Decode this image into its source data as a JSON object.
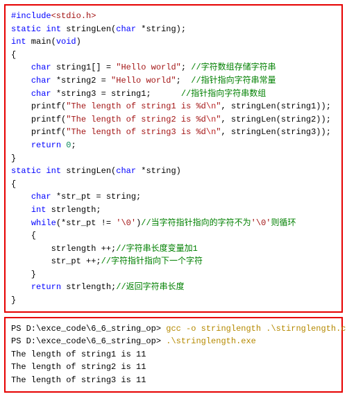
{
  "code": {
    "l1_pre": "#include",
    "l1_inc": "<stdio.h>",
    "l2_kw1": "static",
    "l2_kw2": "int",
    "l2_fn": " stringLen(",
    "l2_kw3": "char",
    "l2_rest": " *string);",
    "l3_kw1": "int",
    "l3_fn": " main(",
    "l3_kw2": "void",
    "l3_rest": ")",
    "l4": "{",
    "l5_ind": "    ",
    "l5_kw": "char",
    "l5_mid": " string1[] = ",
    "l5_str": "\"Hello world\"",
    "l5_semi": "; ",
    "l5_cmt": "//字符数组存储字符串",
    "l6_ind": "    ",
    "l6_kw": "char",
    "l6_mid": " *string2 = ",
    "l6_str": "\"Hello world\"",
    "l6_semi": ";  ",
    "l6_cmt": "//指针指向字符串常量",
    "l7_ind": "    ",
    "l7_kw": "char",
    "l7_mid": " *string3 = string1;      ",
    "l7_cmt": "//指针指向字符串数组",
    "l8_ind": "    ",
    "l8_fn": "printf(",
    "l8_str_a": "\"The length of string1 is ",
    "l8_fmt": "%d",
    "l8_nl": "\\n",
    "l8_str_b": "\"",
    "l8_rest": ", stringLen(string1));",
    "l9_ind": "    ",
    "l9_fn": "printf(",
    "l9_str_a": "\"The length of string2 is ",
    "l9_fmt": "%d",
    "l9_nl": "\\n",
    "l9_str_b": "\"",
    "l9_rest": ", stringLen(string2));",
    "l10_ind": "    ",
    "l10_fn": "printf(",
    "l10_str_a": "\"The length of string3 is ",
    "l10_fmt": "%d",
    "l10_nl": "\\n",
    "l10_str_b": "\"",
    "l10_rest": ", stringLen(string3));",
    "l11_ind": "    ",
    "l11_kw": "return",
    "l11_sp": " ",
    "l11_num": "0",
    "l11_semi": ";",
    "l12": "}",
    "l13_kw1": "static",
    "l13_kw2": "int",
    "l13_fn": " stringLen(",
    "l13_kw3": "char",
    "l13_rest": " *string)",
    "l14": "{",
    "l15_ind": "    ",
    "l15_kw": "char",
    "l15_rest": " *str_pt = string;",
    "l16_ind": "    ",
    "l16_kw": "int",
    "l16_rest": " strlength;",
    "l17_ind": "    ",
    "l17_kw": "while",
    "l17_mid": "(*str_pt != ",
    "l17_chr": "'\\0'",
    "l17_close": ")",
    "l17_cmt_a": "//当字符指针指向的字符不为",
    "l17_chr2": "'\\0'",
    "l17_cmt_b": "则循环",
    "l18": "    {",
    "l19_ind": "        ",
    "l19_stmt": "strlength ++;",
    "l19_cmt": "//字符串长度变量加1",
    "l20_ind": "        ",
    "l20_stmt": "str_pt ++;",
    "l20_cmt": "//字符指针指向下一个字符",
    "l21": "    }",
    "l22_ind": "    ",
    "l22_kw": "return",
    "l22_rest": " strlength;",
    "l22_cmt": "//返回字符串长度",
    "l23": "}"
  },
  "term": {
    "p1_prompt": "PS D:\\exce_code\\6_6_string_op> ",
    "p1_cmd": "gcc -o stringlength .\\stirnglength.c",
    "p2_prompt": "PS D:\\exce_code\\6_6_string_op> ",
    "p2_cmd": ".\\stringlength.exe",
    "o1": "The length of string1 is 11",
    "o2": "The length of string2 is 11",
    "o3": "The length of string3 is 11"
  }
}
